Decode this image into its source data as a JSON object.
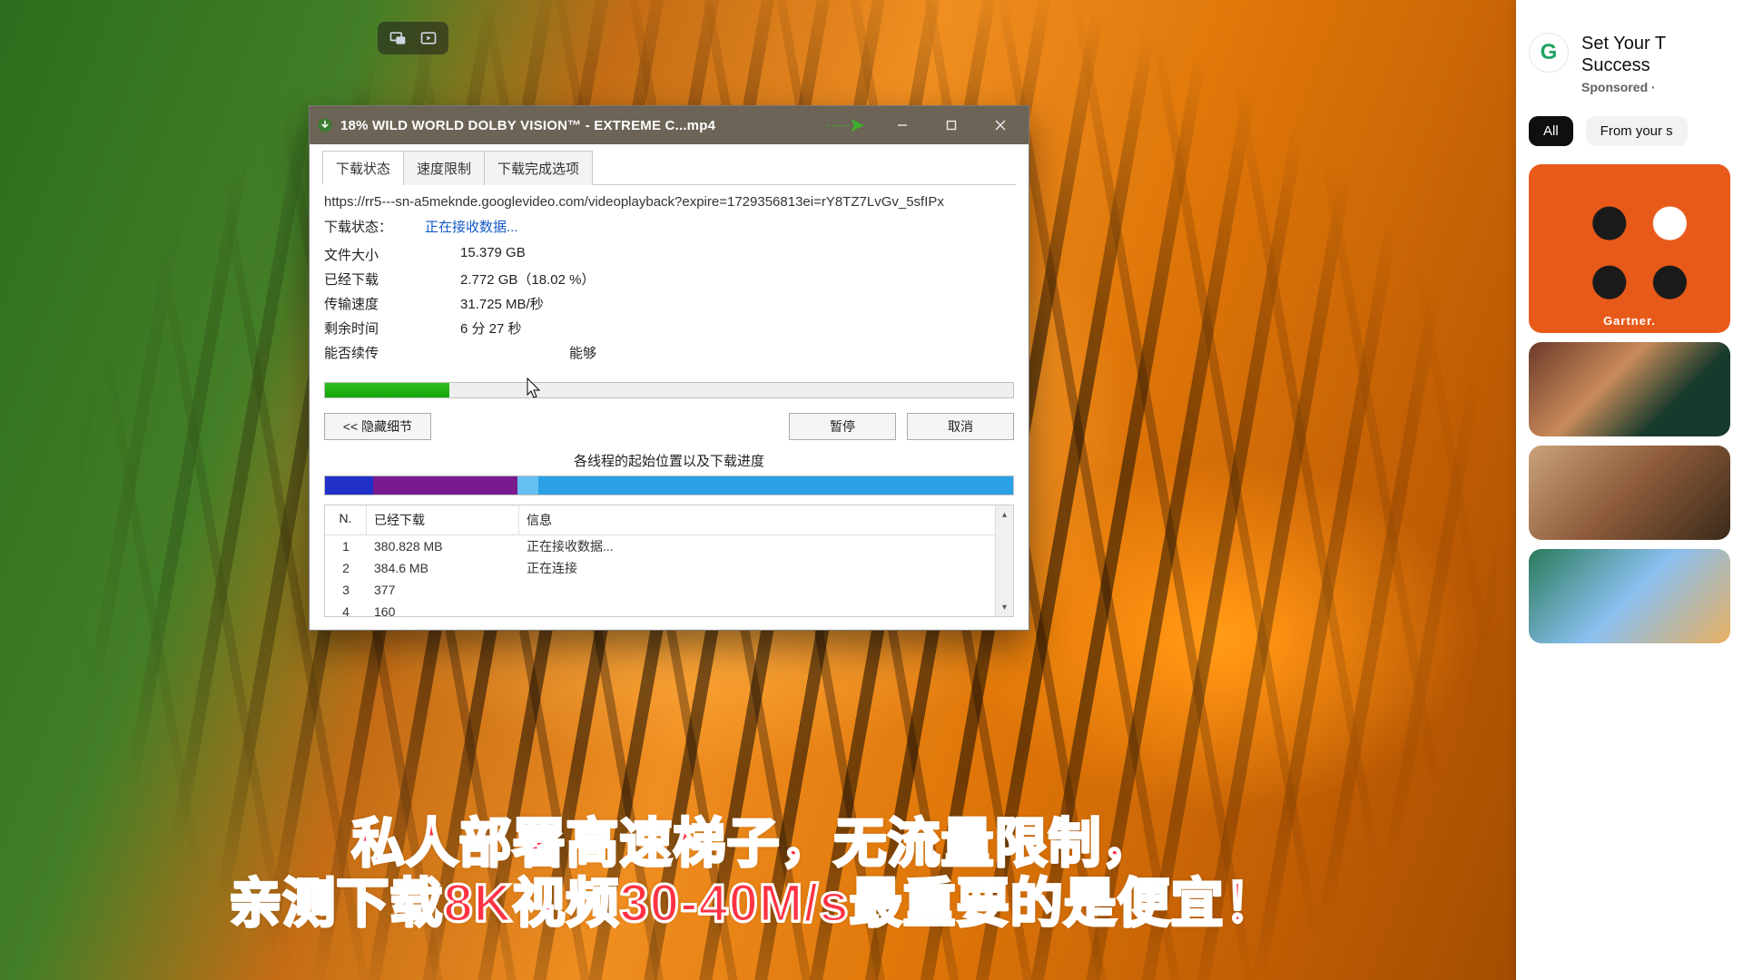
{
  "window": {
    "title": "18% WILD WORLD DOLBY VISION™ - EXTREME C...mp4"
  },
  "tabs": {
    "status": "下载状态",
    "speed_limit": "速度限制",
    "on_complete": "下载完成选项"
  },
  "url": "https://rr5---sn-a5meknde.googlevideo.com/videoplayback?expire=1729356813ei=rY8TZ7LvGv_5sfIPx",
  "status": {
    "label": "下载状态：",
    "value": "正在接收数据..."
  },
  "fields": {
    "file_size": {
      "label": "文件大小",
      "value": "15.379 GB"
    },
    "downloaded": {
      "label": "已经下载",
      "value": "2.772 GB（18.02 %）"
    },
    "transfer_rate": {
      "label": "传输速度",
      "value": "31.725 MB/秒"
    },
    "time_left": {
      "label": "剩余时间",
      "value": "6 分 27 秒"
    },
    "resume": {
      "label": "能否续传",
      "value": "能够"
    }
  },
  "progress_percent": 18.02,
  "buttons": {
    "hide_details": "<< 隐藏细节",
    "pause": "暂停",
    "cancel": "取消"
  },
  "threads_title": "各线程的起始位置以及下载进度",
  "segments": [
    {
      "color": "#2030c8",
      "pct": 7
    },
    {
      "color": "#7a1a8f",
      "pct": 21
    },
    {
      "color": "#65bff0",
      "pct": 3
    },
    {
      "color": "#2aa1e6",
      "pct": 69
    }
  ],
  "grid": {
    "headers": {
      "n": "N.",
      "downloaded": "已经下载",
      "info": "信息"
    },
    "rows": [
      {
        "n": "1",
        "downloaded": "380.828 MB",
        "info": "正在接收数据..."
      },
      {
        "n": "2",
        "downloaded": "384.6  MB",
        "info": "正在连接"
      },
      {
        "n": "3",
        "downloaded": "377",
        "info": ""
      },
      {
        "n": "4",
        "downloaded": "160",
        "info": ""
      }
    ]
  },
  "sidebar": {
    "ad": {
      "title1": "Set Your T",
      "title2": "Success",
      "sponsored": "Sponsored ·"
    },
    "chips": {
      "all": "All",
      "from": "From your s"
    },
    "gartner_label": "Gartner."
  },
  "headline": {
    "line1": "私人部署高速梯子，无流量限制，",
    "line2": "亲测下载8K视频30-40M/s最重要的是便宜！"
  }
}
